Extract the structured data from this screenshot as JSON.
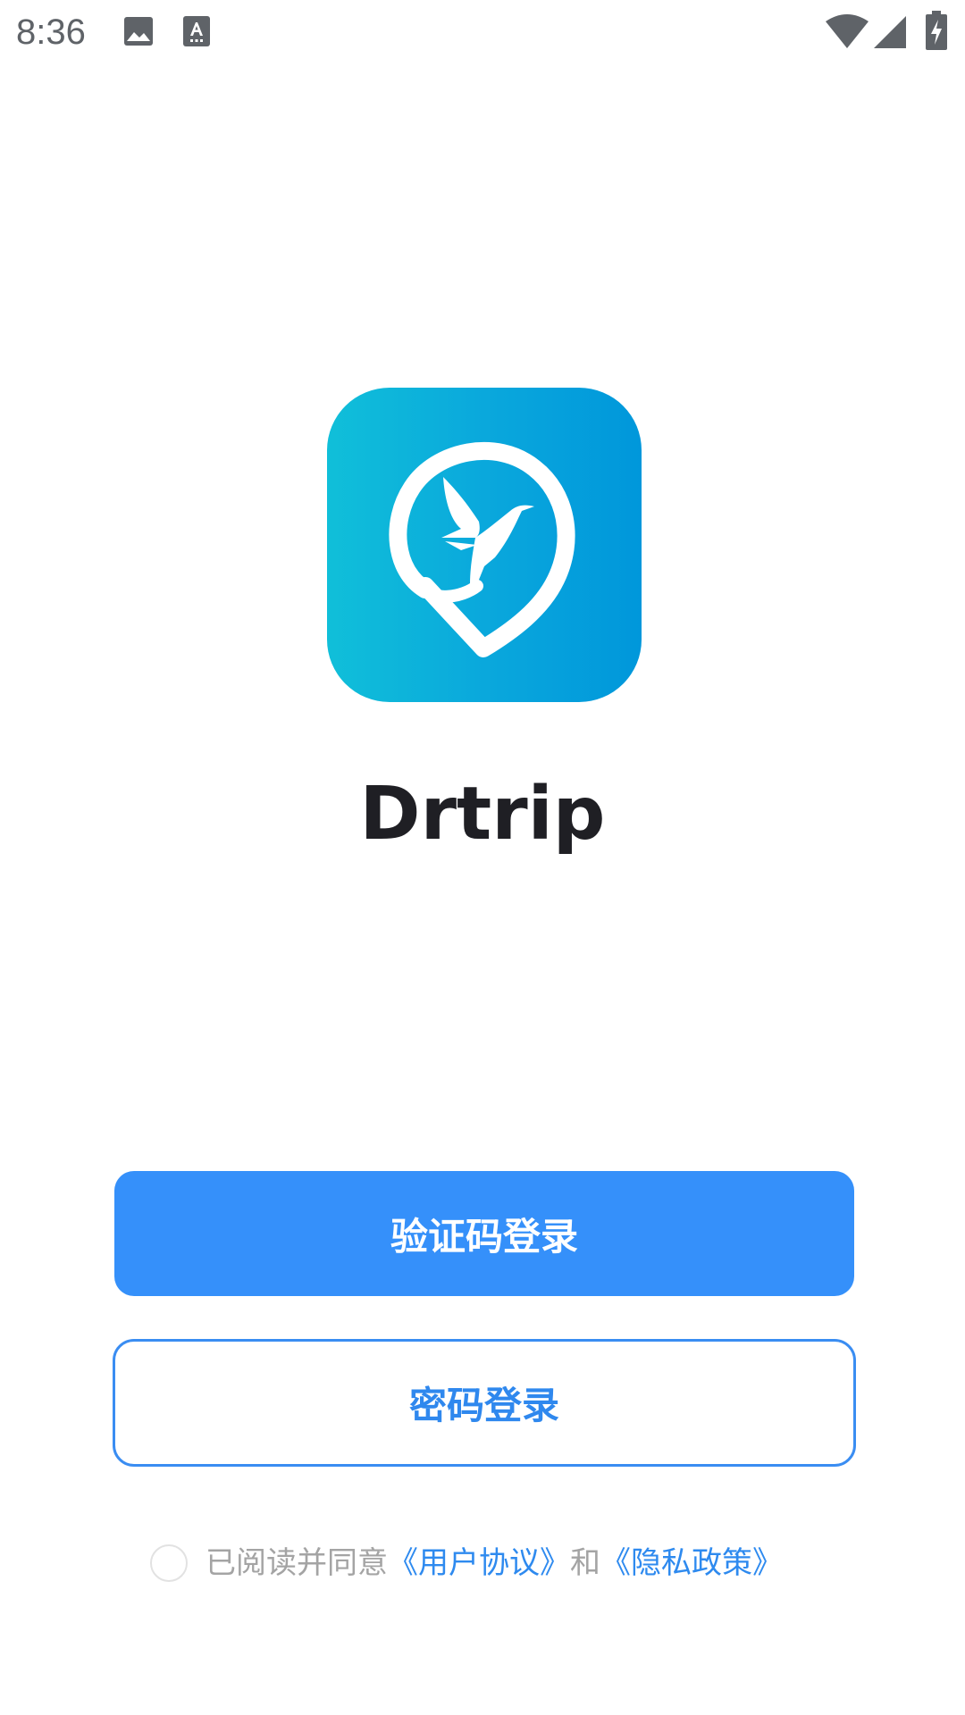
{
  "status_bar": {
    "time": "8:36",
    "icons": [
      "image-icon",
      "keyboard-a-icon",
      "wifi-icon",
      "signal-icon",
      "battery-charging-icon"
    ]
  },
  "app": {
    "name": "Drtrip",
    "logo_icon": "location-pin-bird-icon",
    "logo_colors": [
      "#10bfd9",
      "#0097db"
    ]
  },
  "buttons": {
    "code_login": "验证码登录",
    "password_login": "密码登录"
  },
  "agreement": {
    "prefix": "已阅读并同意",
    "user_agreement": "《用户协议》",
    "conjunction": "和",
    "privacy_policy": "《隐私政策》",
    "checked": false
  },
  "colors": {
    "primary": "#3590fa",
    "link": "#2e8aef",
    "title": "#1f1f24",
    "muted": "#a4a4a4"
  }
}
